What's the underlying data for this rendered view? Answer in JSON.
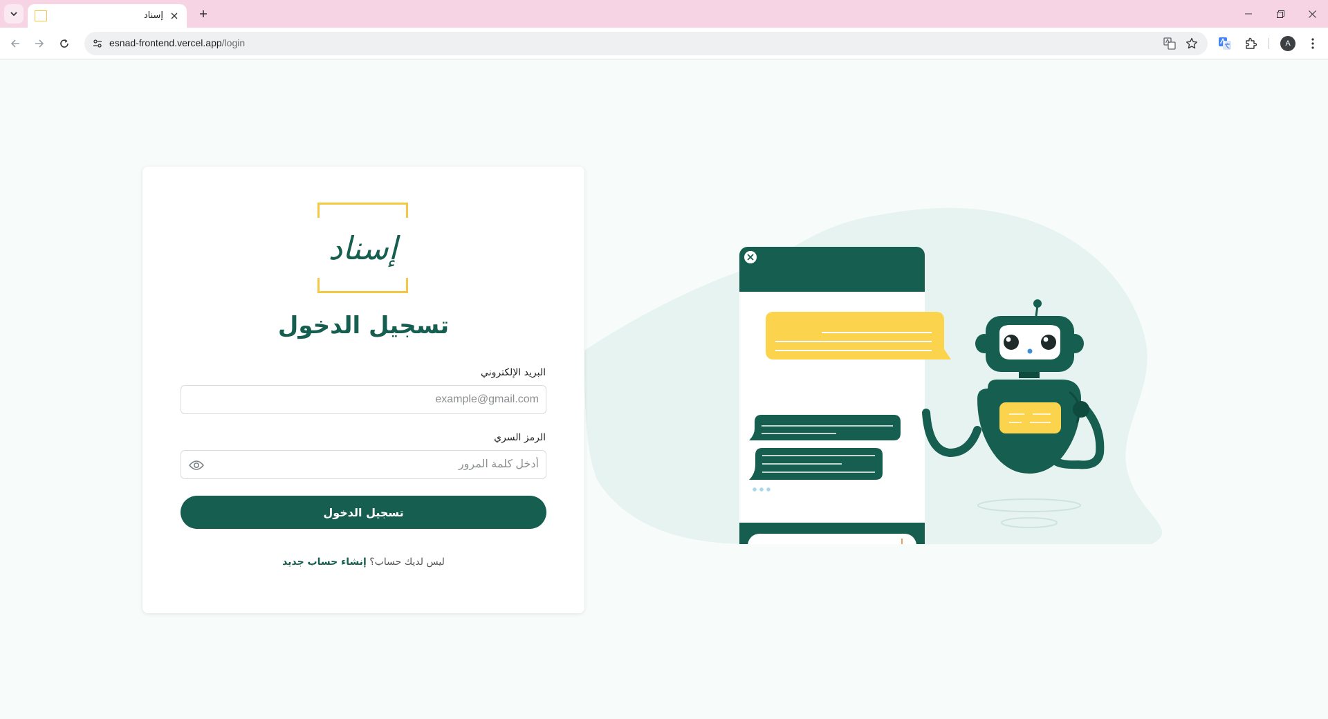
{
  "browser": {
    "tab_title": "إسناد",
    "url_host": "esnad-frontend.vercel.app",
    "url_path": "/login",
    "profile_initial": "A",
    "icons": [
      "tab-list-icon",
      "close-icon",
      "plus-icon",
      "minimize-icon",
      "restore-icon",
      "back-icon",
      "forward-icon",
      "reload-icon",
      "site-info-icon",
      "translate-icon",
      "bookmark-star-icon",
      "google-translate-icon",
      "extensions-icon",
      "menu-kebab-icon"
    ]
  },
  "login": {
    "logo_text": "إسناد",
    "title": "تسجيل الدخول",
    "email_label": "البريد الإلكتروني",
    "email_placeholder": "example@gmail.com",
    "password_label": "الرمز السري",
    "password_placeholder": "أدخل كلمة المرور",
    "submit_label": "تسجيل الدخول",
    "no_account_text": "ليس لديك حساب؟",
    "signup_link": "إنشاء حساب جديد"
  },
  "colors": {
    "brand_green": "#165e4f",
    "accent_yellow": "#fcd34d",
    "tab_strip_pink": "#f6d4e3",
    "page_background": "#f7fcfb",
    "blob_mint": "#e6f3f0"
  }
}
